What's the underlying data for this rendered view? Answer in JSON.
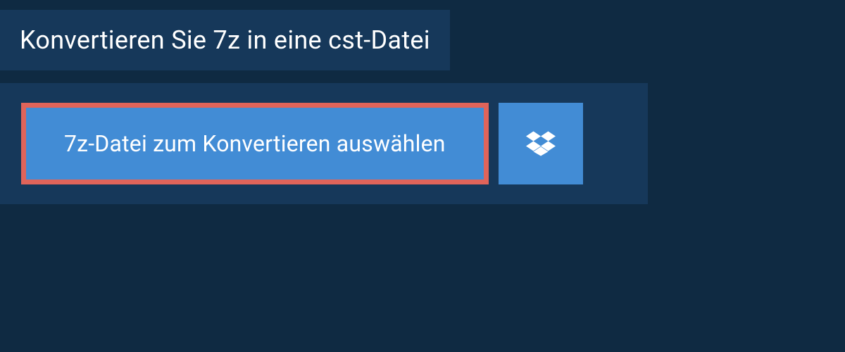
{
  "header": {
    "title": "Konvertieren Sie 7z in eine cst-Datei"
  },
  "actions": {
    "select_file_label": "7z-Datei zum Konvertieren auswählen",
    "dropbox_icon": "dropbox-icon"
  },
  "colors": {
    "background": "#0f2a42",
    "panel": "#16385a",
    "button": "#428cd5",
    "highlight_border": "#e0645a",
    "text": "#ffffff"
  }
}
